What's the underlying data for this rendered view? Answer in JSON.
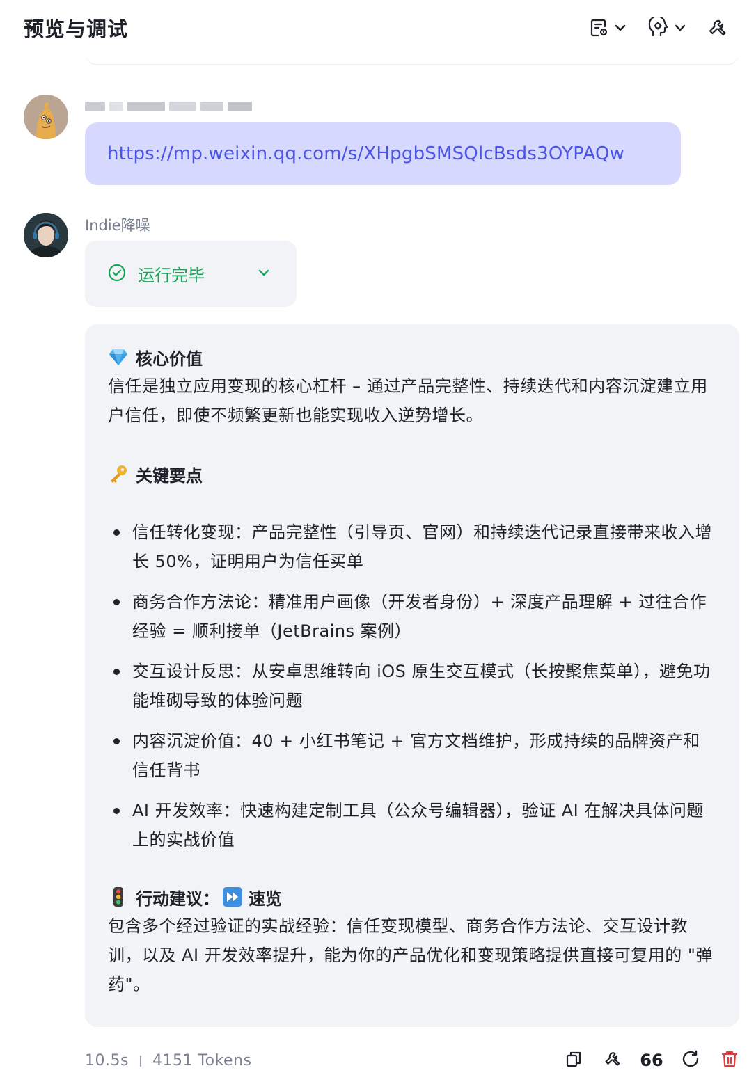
{
  "header": {
    "title": "预览与调试",
    "tools": [
      "debug-list-icon",
      "persona-icon",
      "wrench-icon"
    ]
  },
  "user_message": {
    "link": "https://mp.weixin.qq.com/s/XHpgbSMSQlcBsds3OYPAQw"
  },
  "bot_message": {
    "name": "Indie降噪",
    "run_status": "运行完毕",
    "sections": {
      "core": {
        "emoji": "gem",
        "title": "核心价值",
        "text": "信任是独立应用变现的核心杠杆 – 通过产品完整性、持续迭代和内容沉淀建立用户信任，即使不频繁更新也能实现收入逆势增长。"
      },
      "key_points": {
        "emoji": "key",
        "title": "关键要点",
        "items": [
          "信任转化变现：产品完整性（引导页、官网）和持续迭代记录直接带来收入增长 50%，证明用户为信任买单",
          "商务合作方法论：精准用户画像（开发者身份）+ 深度产品理解 + 过往合作经验 = 顺利接单（JetBrains 案例）",
          "交互设计反思：从安卓思维转向 iOS 原生交互模式（长按聚焦菜单），避免功能堆砌导致的体验问题",
          "内容沉淀价值：40 + 小红书笔记 + 官方文档维护，形成持续的品牌资产和信任背书",
          "AI 开发效率：快速构建定制工具（公众号编辑器），验证 AI 在解决具体问题上的实战价值"
        ]
      },
      "action": {
        "emoji": "traffic-light",
        "title_prefix": "行动建议：",
        "title_suffix": "速览",
        "badge_icon": "fast-forward",
        "text": "包含多个经过验证的实战经验：信任变现模型、商务合作方法论、交互设计教训，以及 AI 开发效率提升，能为你的产品优化和变现策略提供直接可复用的 \"弹药\"。"
      }
    }
  },
  "footer": {
    "duration": "10.5s",
    "tokens": "4151 Tokens",
    "quote_label": "66",
    "actions": [
      "copy-icon",
      "wrench-icon",
      "quote-icon",
      "regenerate-icon",
      "delete-icon"
    ]
  },
  "colors": {
    "user_bubble": "#d6d9fd",
    "link": "#4a55e8",
    "success": "#18a55a",
    "card_bg": "#f2f3f6",
    "delete": "#e5383b"
  }
}
